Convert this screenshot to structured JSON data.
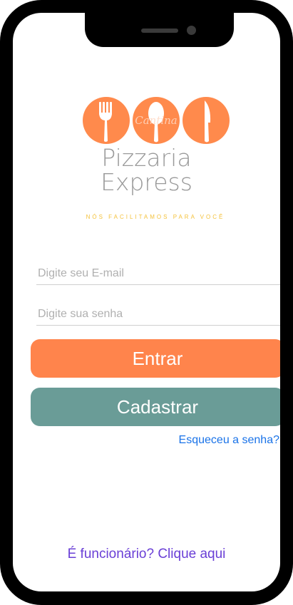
{
  "logo": {
    "script_text": "Cantina",
    "title_line1": "Pizzaria",
    "title_line2": "Express",
    "tagline": "NÓS FACILITAMOS PARA VOCÊ",
    "accent_color": "#ff8a4c"
  },
  "login": {
    "email_placeholder": "Digite seu E-mail",
    "password_placeholder": "Digite sua senha",
    "enter_label": "Entrar",
    "register_label": "Cadastrar",
    "forgot_label": "Esqueceu a senha?",
    "staff_label": "É funcionário? Clique aqui"
  },
  "colors": {
    "enter_button": "#ff844c",
    "register_button": "#6a9c97",
    "forgot_link": "#1a73e8",
    "staff_link": "#6a3fd6"
  }
}
